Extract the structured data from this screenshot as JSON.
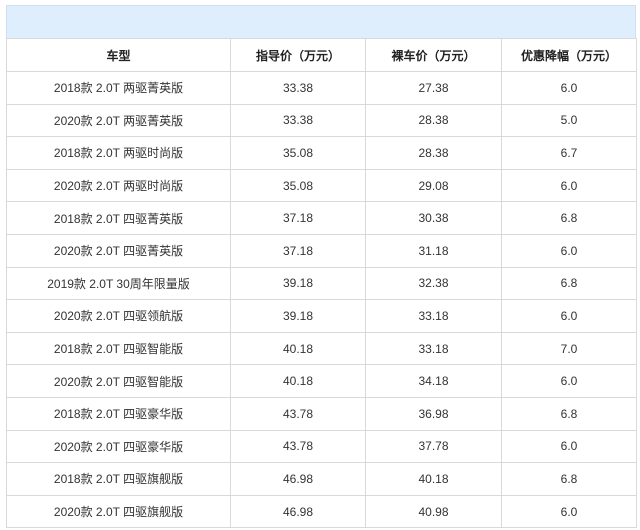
{
  "table": {
    "headers": [
      "车型",
      "指导价（万元）",
      "裸车价（万元）",
      "优惠降幅（万元）"
    ],
    "rows": [
      [
        "2018款 2.0T 两驱菁英版",
        "33.38",
        "27.38",
        "6.0"
      ],
      [
        "2020款 2.0T 两驱菁英版",
        "33.38",
        "28.38",
        "5.0"
      ],
      [
        "2018款 2.0T 两驱时尚版",
        "35.08",
        "28.38",
        "6.7"
      ],
      [
        "2020款 2.0T 两驱时尚版",
        "35.08",
        "29.08",
        "6.0"
      ],
      [
        "2018款 2.0T 四驱菁英版",
        "37.18",
        "30.38",
        "6.8"
      ],
      [
        "2020款 2.0T 四驱菁英版",
        "37.18",
        "31.18",
        "6.0"
      ],
      [
        "2019款 2.0T 30周年限量版",
        "39.18",
        "32.38",
        "6.8"
      ],
      [
        "2020款 2.0T 四驱领航版",
        "39.18",
        "33.18",
        "6.0"
      ],
      [
        "2018款 2.0T 四驱智能版",
        "40.18",
        "33.18",
        "7.0"
      ],
      [
        "2020款 2.0T 四驱智能版",
        "40.18",
        "34.18",
        "6.0"
      ],
      [
        "2018款 2.0T 四驱豪华版",
        "43.78",
        "36.98",
        "6.8"
      ],
      [
        "2020款 2.0T 四驱豪华版",
        "43.78",
        "37.78",
        "6.0"
      ],
      [
        "2018款 2.0T 四驱旗舰版",
        "46.98",
        "40.18",
        "6.8"
      ],
      [
        "2020款 2.0T 四驱旗舰版",
        "46.98",
        "40.98",
        "6.0"
      ]
    ]
  },
  "colors": {
    "banner": "#dfeefc",
    "border": "#d9d9d9",
    "text": "#333333"
  }
}
